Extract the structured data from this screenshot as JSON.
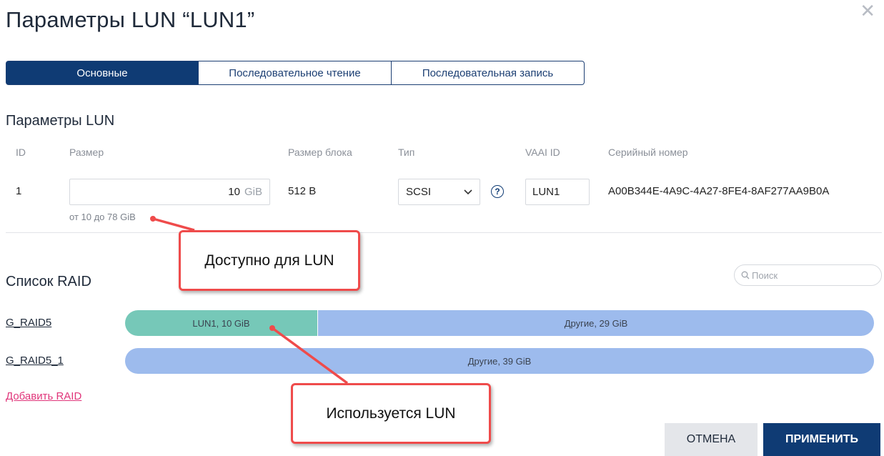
{
  "dialog": {
    "title": "Параметры LUN “LUN1”",
    "close_icon": "close-icon"
  },
  "tabs": [
    {
      "label": "Основные",
      "active": true
    },
    {
      "label": "Последовательное чтение",
      "active": false
    },
    {
      "label": "Последовательная запись",
      "active": false
    }
  ],
  "lun_params": {
    "section_title": "Параметры LUN",
    "headers": {
      "id": "ID",
      "size": "Размер",
      "block_size": "Размер блока",
      "type": "Тип",
      "vaai_id": "VAAI ID",
      "serial": "Серийный номер"
    },
    "row": {
      "id": "1",
      "size_value": "10",
      "size_unit": "GiB",
      "size_hint": "от 10 до 78 GiB",
      "block_size": "512 B",
      "type": "SCSI",
      "help_icon": "?",
      "vaai_id": "LUN1",
      "serial": "A00B344E-4A9C-4A27-8FE4-8AF277AA9B0A"
    }
  },
  "raid_list": {
    "section_title": "Список RAID",
    "search_placeholder": "Поиск",
    "items": [
      {
        "name": "G_RAID5",
        "segments": [
          {
            "label": "LUN1, 10 GiB",
            "value_gib": 10,
            "color": "#76c8b8"
          },
          {
            "label": "Другие, 29 GiB",
            "value_gib": 29,
            "color": "#9dbbed"
          }
        ]
      },
      {
        "name": "G_RAID5_1",
        "segments": [
          {
            "label": "Другие, 39 GiB",
            "value_gib": 39,
            "color": "#9dbbed"
          }
        ]
      }
    ],
    "add_label": "Добавить RAID"
  },
  "callouts": {
    "available": "Доступно для LUN",
    "used": "Используется LUN",
    "color": "#ef4b4b"
  },
  "buttons": {
    "cancel": "ОТМЕНА",
    "apply": "ПРИМЕНИТЬ"
  },
  "colors": {
    "primary": "#0f3b74",
    "link_pink": "#e0357a"
  }
}
